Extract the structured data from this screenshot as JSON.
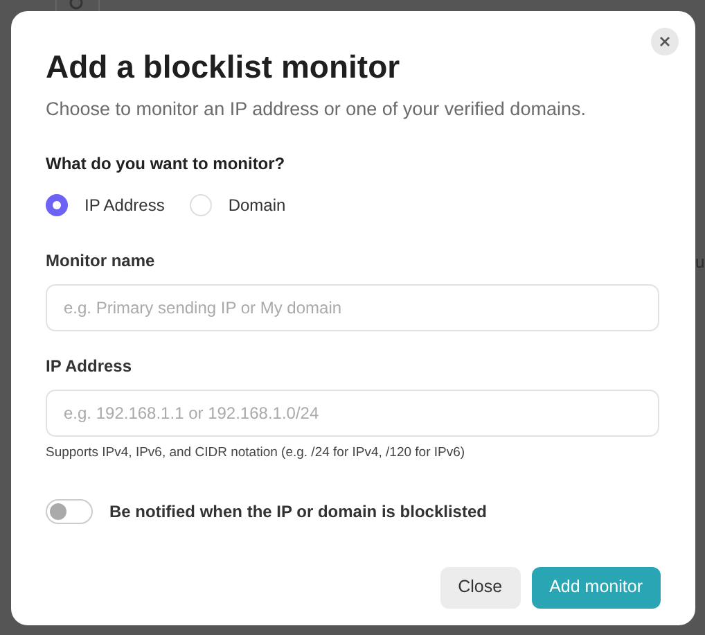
{
  "background": {
    "text_fragment": "u"
  },
  "dialog": {
    "title": "Add a blocklist monitor",
    "subtitle": "Choose to monitor an IP address or one of your verified domains.",
    "question": "What do you want to monitor?",
    "options": [
      {
        "label": "IP Address",
        "selected": true
      },
      {
        "label": "Domain",
        "selected": false
      }
    ],
    "fields": [
      {
        "label": "Monitor name",
        "placeholder": "e.g. Primary sending IP or My domain"
      },
      {
        "label": "IP Address",
        "placeholder": "e.g. 192.168.1.1 or 192.168.1.0/24",
        "hint": "Supports IPv4, IPv6, and CIDR notation (e.g. /24 for IPv4, /120 for IPv6)"
      }
    ],
    "notify": {
      "label": "Be notified when the IP or domain is blocklisted",
      "on": false
    },
    "buttons": [
      {
        "label": "Close",
        "kind": "secondary"
      },
      {
        "label": "Add monitor",
        "kind": "primary"
      }
    ]
  }
}
